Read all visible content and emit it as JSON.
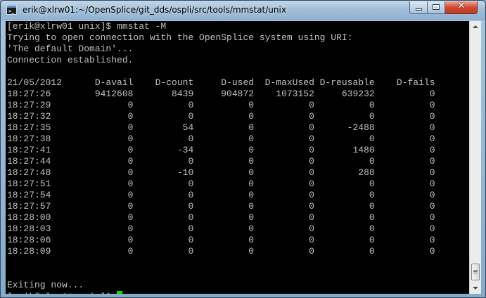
{
  "window": {
    "title": "erik@xlrw01:~/OpenSplice/git_dds/ospli/src/tools/mmstat/unix",
    "app_icon": "terminal-icon",
    "controls": {
      "minimize": "minimize-icon",
      "maximize": "maximize-icon",
      "close": "close-icon",
      "close_glyph": "✕"
    }
  },
  "terminal": {
    "lines": [
      "[erik@xlrw01 unix]$ mmstat -M",
      "Trying to open connection with the OpenSplice system using URI:",
      "'The default Domain'...",
      "Connection established.",
      "",
      "21/05/2012      D-avail    D-count     D-used  D-maxUsed D-reusable    D-fails",
      "18:27:26        9412608       8439     904872    1073152     639232          0",
      "18:27:29              0          0          0          0          0          0",
      "18:27:32              0          0          0          0          0          0",
      "18:27:35              0         54          0          0      -2488          0",
      "18:27:38              0          0          0          0          0          0",
      "18:27:41              0        -34          0          0       1480          0",
      "18:27:44              0          0          0          0          0          0",
      "18:27:48              0        -10          0          0        288          0",
      "18:27:51              0          0          0          0          0          0",
      "18:27:54              0          0          0          0          0          0",
      "18:27:57              0          0          0          0          0          0",
      "18:28:00              0          0          0          0          0          0",
      "18:28:03              0          0          0          0          0          0",
      "18:28:06              0          0          0          0          0          0",
      "18:28:09              0          0          0          0          0          0",
      "",
      "",
      "Exiting now..."
    ],
    "prompt": "[erik@xlrw01 unix]$ ",
    "colors": {
      "background": "#000000",
      "foreground": "#c0c0c0",
      "cursor": "#00e000"
    }
  },
  "scrollbar": {
    "up_icon": "scroll-up-arrow-icon",
    "down_icon": "scroll-down-arrow-icon"
  }
}
